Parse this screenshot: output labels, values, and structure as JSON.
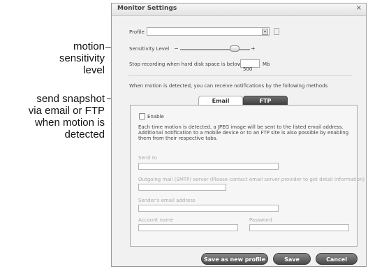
{
  "callouts": {
    "motion": [
      "motion",
      "sensitivity",
      "level"
    ],
    "snapshot": [
      "send snapshot",
      "via email or FTP",
      "when motion is",
      "detected"
    ]
  },
  "dialog": {
    "title": "Monitor Settings",
    "close_glyph": "×",
    "profile_label": "Profile",
    "profile_value": "",
    "sensitivity_label": "Sensitivity Level",
    "sensitivity_minus": "−",
    "sensitivity_plus": "+",
    "sensitivity_level": 0.7,
    "disk_label": "Stop recording when hard disk space is below",
    "disk_value": "500",
    "disk_unit": "Mb",
    "notify_text": "When motion is detected, you can receive notifications by the following methods",
    "tabs": [
      "Email",
      "FTP"
    ],
    "active_tab": "Email",
    "email_panel": {
      "enable_label": "Enable",
      "enable_checked": false,
      "description": "Each time motion is detected, a JPEG image will be sent to the listed email address. Additional notification to a mobile device or to an FTP site is also possible by enabling them from their respective tabs.",
      "send_to_label": "Send to",
      "send_to_value": "",
      "smtp_label": "Outgoing mail (SMTP) server (Please contact email server provider to get detail information)",
      "smtp_value": "",
      "sender_label": "Sender's email address",
      "sender_value": "",
      "account_label": "Account name",
      "account_value": "",
      "password_label": "Password",
      "password_value": ""
    },
    "buttons": {
      "save_as_new": "Save as new profile",
      "save": "Save",
      "cancel": "Cancel"
    }
  },
  "icons": [
    "dropdown-arrow-icon",
    "trash-icon",
    "close-icon"
  ]
}
